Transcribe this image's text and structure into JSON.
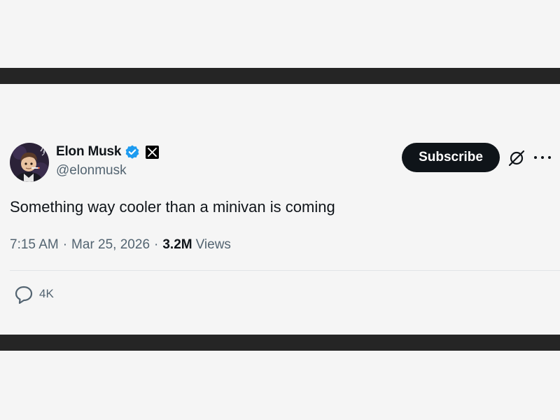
{
  "author": {
    "display_name": "Elon Musk",
    "handle": "@elonmusk",
    "verified": true,
    "affiliation_badge": "x-logo-icon",
    "avatar": "avatar-image"
  },
  "actions": {
    "subscribe_label": "Subscribe",
    "grok_icon": "grok-icon",
    "more_icon": "more-options-icon"
  },
  "tweet": {
    "text": "Something way cooler than a minivan is coming",
    "time": "7:15 AM",
    "date": "Mar 25, 2026",
    "separator": "·",
    "views_count": "3.2M",
    "views_label": "Views"
  },
  "engagement": {
    "replies": "4K",
    "reply_icon": "reply-icon"
  },
  "colors": {
    "background": "#f5f5f5",
    "band": "#252525",
    "text_primary": "#0f1419",
    "text_secondary": "#536471",
    "verified_blue": "#1d9bf0",
    "button": "#0f1419"
  }
}
